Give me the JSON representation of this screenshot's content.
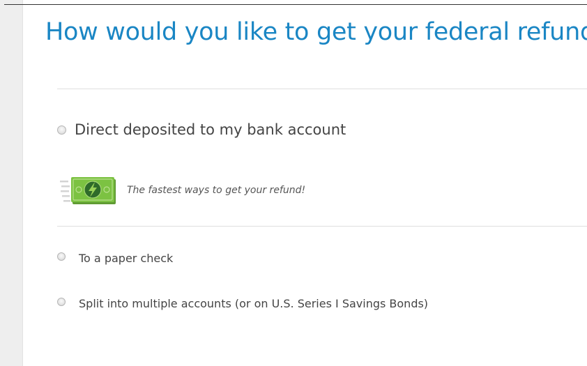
{
  "page": {
    "title": "How would you like to get your federal refund?"
  },
  "options": {
    "direct_deposit": {
      "label": "Direct deposited to my bank account",
      "selected": false
    },
    "promo": {
      "text": "The fastest ways to get your refund!",
      "icon": "fast-money-icon"
    },
    "paper_check": {
      "label": "To a paper check",
      "selected": false
    },
    "split": {
      "label": "Split into multiple accounts (or on U.S. Series I Savings Bonds)",
      "selected": false
    }
  },
  "colors": {
    "title": "#1a86c4",
    "money_green": "#7cc242",
    "text": "#444444"
  }
}
